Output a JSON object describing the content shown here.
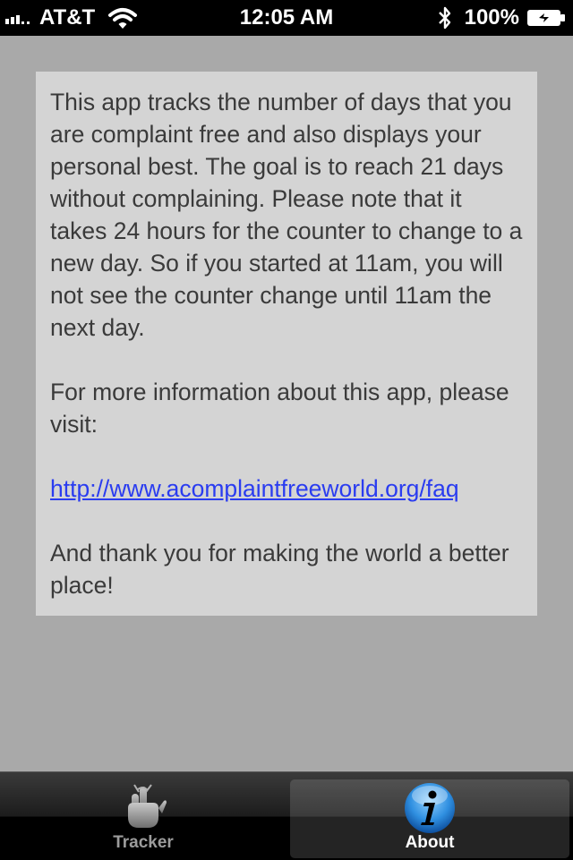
{
  "status_bar": {
    "carrier": "AT&T",
    "time": "12:05 AM",
    "battery": "100%",
    "icons": [
      "signal-icon",
      "wifi-icon",
      "bluetooth-icon",
      "battery-icon"
    ]
  },
  "about": {
    "paragraph1": "This app tracks the number of days that you are complaint free and also displays your personal best. The goal is to reach 21 days without complaining. Please note that it takes 24 hours for the counter to change to a new day. So if you started at 11am, you will not see the counter change until 11am the next day.",
    "paragraph2": "For more information about this app, please visit:",
    "link": "http://www.acomplaintfreeworld.org/faq",
    "paragraph3": "And thank you for making the world a better place!"
  },
  "tab_bar": {
    "tabs": [
      {
        "label": "Tracker",
        "icon": "finger-ribbon-icon",
        "selected": false
      },
      {
        "label": "About",
        "icon": "info-icon",
        "selected": true
      }
    ]
  },
  "colors": {
    "background": "#a9a9a9",
    "card": "#d4d4d4",
    "link": "#2a3cf0",
    "tab_bar": "#1c1c1c"
  }
}
